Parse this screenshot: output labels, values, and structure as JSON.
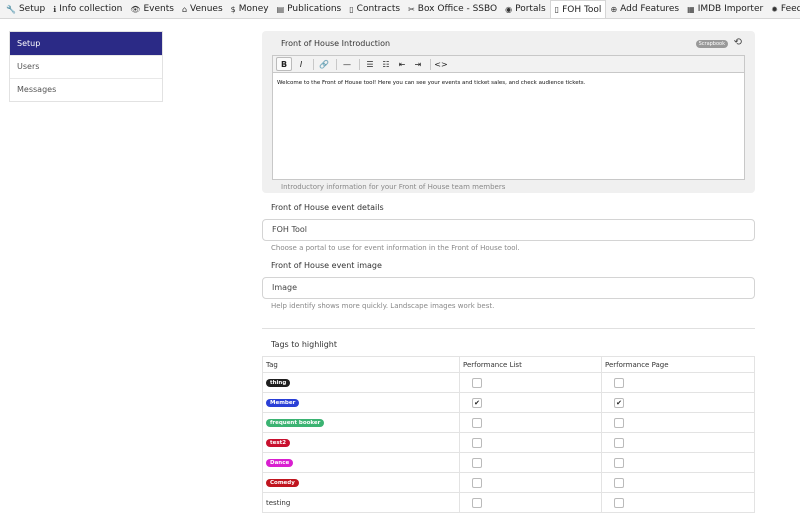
{
  "nav": {
    "tabs": [
      {
        "label": "Setup",
        "icon": "wrench-icon",
        "glyph": "🔧"
      },
      {
        "label": "Info collection",
        "icon": "info-icon",
        "glyph": "ℹ"
      },
      {
        "label": "Events",
        "icon": "eye-icon",
        "glyph": "👁"
      },
      {
        "label": "Venues",
        "icon": "venue-icon",
        "glyph": "⌂"
      },
      {
        "label": "Money",
        "icon": "dollar-icon",
        "glyph": "$"
      },
      {
        "label": "Publications",
        "icon": "publications-icon",
        "glyph": "▤"
      },
      {
        "label": "Contracts",
        "icon": "contracts-icon",
        "glyph": "▯"
      },
      {
        "label": "Box Office - SSBO",
        "icon": "ticket-icon",
        "glyph": "✂"
      },
      {
        "label": "Portals",
        "icon": "globe-icon",
        "glyph": "◉"
      },
      {
        "label": "FOH Tool",
        "icon": "tablet-icon",
        "glyph": "▯"
      },
      {
        "label": "Add Features",
        "icon": "plus-circle-icon",
        "glyph": "⊕"
      },
      {
        "label": "IMDB Importer",
        "icon": "film-icon",
        "glyph": "▦"
      },
      {
        "label": "Feedback",
        "icon": "gear-icon",
        "glyph": "✹"
      }
    ],
    "active_index": 9
  },
  "sidebar": {
    "items": [
      {
        "label": "Setup"
      },
      {
        "label": "Users"
      },
      {
        "label": "Messages"
      }
    ]
  },
  "intro": {
    "title": "Front of House Introduction",
    "scrapbook": "Scrapbook",
    "body": "Welcome to the Front of House tool! Here you can see your events and ticket sales, and check audience tickets.",
    "hint": "Introductory information for your Front of House team members"
  },
  "toolbar": {
    "bold": "B",
    "italic": "I",
    "link": "🔗",
    "hr": "—",
    "ul": "☰",
    "ol": "☷",
    "outdent": "⇤",
    "indent": "⇥",
    "code": "<>"
  },
  "event_details": {
    "label": "Front of House event details",
    "value": "FOH Tool",
    "hint": "Choose a portal to use for event information in the Front of House tool."
  },
  "event_image": {
    "label": "Front of House event image",
    "value": "Image",
    "hint": "Help identify shows more quickly. Landscape images work best."
  },
  "tags": {
    "title": "Tags to highlight",
    "headers": [
      "Tag",
      "Performance List",
      "Performance Page"
    ],
    "rows": [
      {
        "name": "thing",
        "color": "#1e1e1e",
        "list": false,
        "page": false,
        "pill": true
      },
      {
        "name": "Member",
        "color": "#2a3fd6",
        "list": true,
        "page": true,
        "pill": true
      },
      {
        "name": "frequent booker",
        "color": "#3bb372",
        "list": false,
        "page": false,
        "pill": true
      },
      {
        "name": "test2",
        "color": "#c8102e",
        "list": false,
        "page": false,
        "pill": true
      },
      {
        "name": "Dance",
        "color": "#d91fd0",
        "list": false,
        "page": false,
        "pill": true
      },
      {
        "name": "Comedy",
        "color": "#c0151f",
        "list": false,
        "page": false,
        "pill": true
      },
      {
        "name": "testing",
        "color": "",
        "list": false,
        "page": false,
        "pill": false
      }
    ]
  }
}
